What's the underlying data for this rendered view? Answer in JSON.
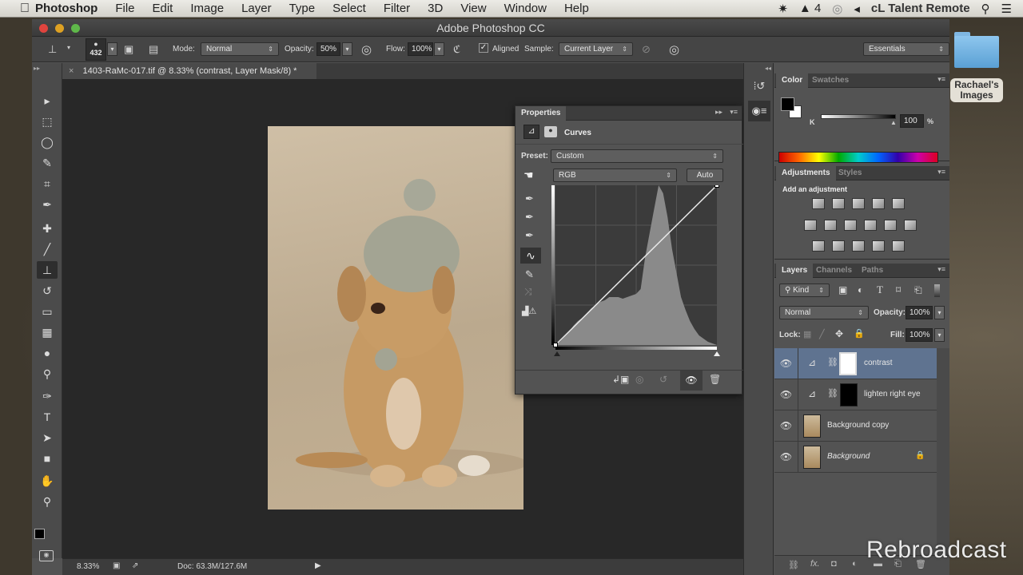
{
  "menubar": {
    "app_name": "Photoshop",
    "items": [
      "File",
      "Edit",
      "Image",
      "Layer",
      "Type",
      "Select",
      "Filter",
      "3D",
      "View",
      "Window",
      "Help"
    ],
    "status_items": {
      "adobe_badge_count": "4",
      "user": "cL Talent Remote"
    }
  },
  "window": {
    "title": "Adobe Photoshop CC"
  },
  "options_bar": {
    "brush_size": "432",
    "mode_label": "Mode:",
    "mode_value": "Normal",
    "opacity_label": "Opacity:",
    "opacity_value": "50%",
    "flow_label": "Flow:",
    "flow_value": "100%",
    "aligned_label": "Aligned",
    "aligned_checked": true,
    "sample_label": "Sample:",
    "sample_value": "Current Layer",
    "workspace": "Essentials"
  },
  "document": {
    "tab_title": "1403-RaMc-017.tif @ 8.33% (contrast, Layer Mask/8) *",
    "tab_close": "×"
  },
  "status_bar": {
    "zoom": "8.33%",
    "doc_size": "Doc: 63.3M/127.6M"
  },
  "tools": [
    "move",
    "rectangular-marquee",
    "lasso",
    "quick-selection",
    "crop",
    "eyedropper",
    "spot-healing-brush",
    "brush",
    "clone-stamp",
    "history-brush",
    "eraser",
    "gradient",
    "blur",
    "dodge",
    "pen",
    "type",
    "path-selection",
    "rectangle",
    "hand",
    "zoom"
  ],
  "tool_glyphs": [
    "▸",
    "⬚",
    "◯",
    "✎",
    "⌗",
    "✒",
    "✚",
    "╱",
    "⊥",
    "↺",
    "▭",
    "▦",
    "●",
    "⚲",
    "✑",
    "T",
    "➤",
    "■",
    "✋",
    "⚲"
  ],
  "active_tool": "clone-stamp",
  "properties": {
    "tab": "Properties",
    "panel_title": "Curves",
    "preset_label": "Preset:",
    "preset_value": "Custom",
    "channel_value": "RGB",
    "auto_label": "Auto",
    "curve_points": [
      [
        0,
        0
      ],
      [
        255,
        255
      ]
    ]
  },
  "color_panel": {
    "tabs": [
      "Color",
      "Swatches"
    ],
    "slider_label": "K",
    "value": "100",
    "unit": "%",
    "foreground": "#000000",
    "background": "#ffffff"
  },
  "adjustments_panel": {
    "tabs": [
      "Adjustments",
      "Styles"
    ],
    "heading": "Add an adjustment"
  },
  "layers_panel": {
    "tabs": [
      "Layers",
      "Channels",
      "Paths"
    ],
    "filter_kind": "Kind",
    "blend_mode": "Normal",
    "opacity_label": "Opacity:",
    "opacity_value": "100%",
    "lock_label": "Lock:",
    "fill_label": "Fill:",
    "fill_value": "100%",
    "layers": [
      {
        "name": "contrast",
        "type": "curves",
        "mask": "white",
        "selected": true,
        "visible": true
      },
      {
        "name": "lighten right eye",
        "type": "curves",
        "mask": "black",
        "selected": false,
        "visible": true
      },
      {
        "name": "Background copy",
        "type": "image",
        "selected": false,
        "visible": true
      },
      {
        "name": "Background",
        "type": "image",
        "selected": false,
        "visible": true,
        "locked": true
      }
    ]
  },
  "desktop": {
    "folder_label": "Rachael's Images"
  },
  "watermark": "Rebroadcast"
}
